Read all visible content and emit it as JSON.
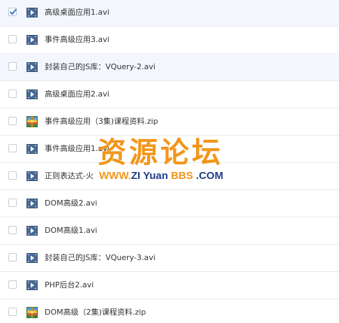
{
  "files": [
    {
      "name": "高级桌面应用1.avi",
      "icon": "video-file-icon",
      "checked": true
    },
    {
      "name": "事件高级应用3.avi",
      "icon": "video-file-icon",
      "checked": false
    },
    {
      "name": "封装自己的JS库：VQuery-2.avi",
      "icon": "video-file-icon",
      "checked": false
    },
    {
      "name": "高级桌面应用2.avi",
      "icon": "video-file-icon",
      "checked": false
    },
    {
      "name": "事件高级应用（3集)课程资料.zip",
      "icon": "archive-file-icon",
      "checked": false
    },
    {
      "name": "事件高级应用1.avi",
      "icon": "video-file-icon",
      "checked": false
    },
    {
      "name": "正则表达式-火",
      "icon": "video-file-icon",
      "checked": false
    },
    {
      "name": "DOM高级2.avi",
      "icon": "video-file-icon",
      "checked": false
    },
    {
      "name": "DOM高级1.avi",
      "icon": "video-file-icon",
      "checked": false
    },
    {
      "name": "封装自己的JS库：VQuery-3.avi",
      "icon": "video-file-icon",
      "checked": false
    },
    {
      "name": "PHP后台2.avi",
      "icon": "video-file-icon",
      "checked": false
    },
    {
      "name": "DOM高级（2集)课程资料.zip",
      "icon": "archive-file-icon",
      "checked": false
    }
  ],
  "watermark": {
    "title": "资源论坛",
    "url_part1": "WWW.",
    "url_part2": "ZI",
    "url_part3": " Yuan ",
    "url_part4": "BBS",
    "url_part5": " .COM"
  },
  "colors": {
    "watermark_orange": "#f2961b",
    "watermark_blue": "#1f3f86",
    "video_icon": "#4a6a94",
    "row_divider": "#e6e9ee"
  }
}
